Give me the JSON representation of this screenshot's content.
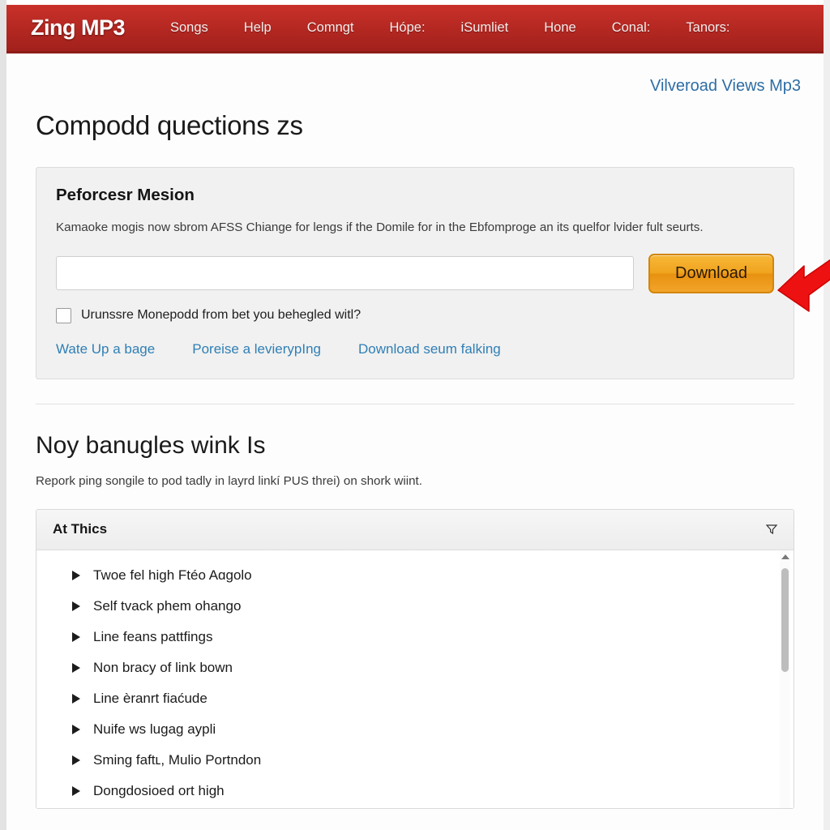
{
  "header": {
    "brand": "Zing MP3",
    "nav": [
      {
        "label": "Songs"
      },
      {
        "label": "Help"
      },
      {
        "label": "Comngt"
      },
      {
        "label": "Hópe:"
      },
      {
        "label": "iSumliet"
      },
      {
        "label": "Hone"
      },
      {
        "label": "Conal:"
      },
      {
        "label": "Tanors:"
      }
    ]
  },
  "main": {
    "top_right_link": "Vilveroad Views Mp3",
    "page_title": "Compodd quections zs",
    "panel": {
      "title": "Peforcesr Mesion",
      "description": "Kamaoke mogis now sbrom AFSS Chiange for lengs if the Domile for in the Ebfomproge an its quelfor lvider fult seurts.",
      "input_value": "",
      "input_placeholder": "",
      "download_label": "Download",
      "checkbox_label": "Urunssre Monepodd from bet you behegled witl?",
      "checkbox_checked": false,
      "links": [
        {
          "label": "Wate Up a bage"
        },
        {
          "label": "Poreise a levierypIng"
        },
        {
          "label": "Download seum falking"
        }
      ]
    },
    "section": {
      "title": "Noy banugles wink Is",
      "description": "Repork ping songile to pod tadly in layrd linkí PUS threi) on shork wiint."
    },
    "list_panel": {
      "header_title": "At Thics",
      "header_icon": "filter-funnel-icon",
      "items": [
        {
          "label": "Twoe fel high Ftéo Aɑgolo"
        },
        {
          "label": "Self tvack phem ohango"
        },
        {
          "label": "Line feans pattfings"
        },
        {
          "label": "Non bracy of link bown"
        },
        {
          "label": "Line èranrt fiaćude"
        },
        {
          "label": "Nuife ws lugag aypli"
        },
        {
          "label": "Sming faftʟ, Mulio Portndon"
        },
        {
          "label": "Dongdoѕioed ort high"
        }
      ]
    }
  },
  "annotation": {
    "arrow": "red-left-arrow-pointing-to-download-button",
    "arrow_color": "#ee1111"
  },
  "colors": {
    "navbar_red": "#b32721",
    "link_blue": "#2f7fb5",
    "button_orange": "#f0a41e",
    "panel_grey": "#f1f1f1"
  }
}
